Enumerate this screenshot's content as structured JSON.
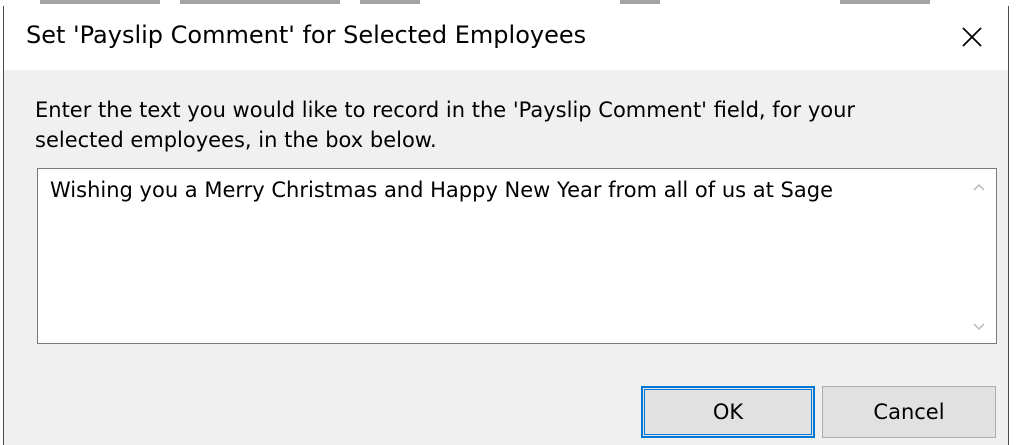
{
  "dialog": {
    "title": "Set 'Payslip Comment' for Selected Employees",
    "close_icon": "close-icon",
    "prompt": "Enter the text you would like to record in the 'Payslip Comment' field, for your selected employees, in the box below.",
    "comment_value": "Wishing you a Merry Christmas and Happy New Year from all of us at Sage",
    "scroll_up_icon": "chevron-up-icon",
    "scroll_down_icon": "chevron-down-icon",
    "ok_label": "OK",
    "cancel_label": "Cancel"
  },
  "colors": {
    "dialog_background": "#f0f0f0",
    "titlebar_background": "#ffffff",
    "focus_accent": "#0078d7",
    "button_face": "#e1e1e1"
  }
}
